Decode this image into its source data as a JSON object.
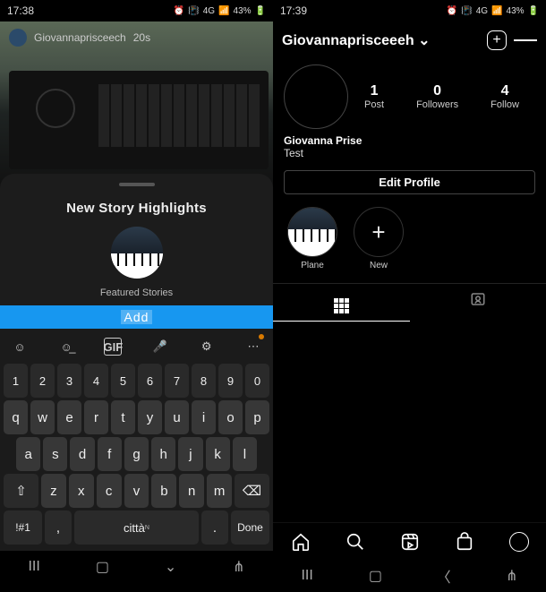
{
  "left": {
    "status": {
      "time": "17:38",
      "battery": "43%",
      "net": "4G"
    },
    "story": {
      "username": "Giovannaprisceech",
      "age": "20s"
    },
    "sheet": {
      "title": "New Story Highlights",
      "featured_label": "Featured Stories",
      "add_label": "Add"
    },
    "keyboard": {
      "toolbar_gif": "GIF",
      "row_nums": [
        "1",
        "2",
        "3",
        "4",
        "5",
        "6",
        "7",
        "8",
        "9",
        "0"
      ],
      "row1": [
        "q",
        "w",
        "e",
        "r",
        "t",
        "y",
        "u",
        "i",
        "o",
        "p"
      ],
      "row2": [
        "a",
        "s",
        "d",
        "f",
        "g",
        "h",
        "j",
        "k",
        "l"
      ],
      "row3": [
        "z",
        "x",
        "c",
        "v",
        "b",
        "n",
        "m"
      ],
      "sym_key": "!#1",
      "comma": ",",
      "space": "città",
      "period": ".",
      "done": "Done"
    }
  },
  "right": {
    "status": {
      "time": "17:39",
      "battery": "43%",
      "net": "4G"
    },
    "header": {
      "username": "Giovannaprisceeeh"
    },
    "stats": {
      "posts": {
        "n": "1",
        "label": "Post"
      },
      "followers": {
        "n": "0",
        "label": "Followers"
      },
      "following": {
        "n": "4",
        "label": "Follow"
      }
    },
    "bio": {
      "name": "Giovanna Prise",
      "text": "Test"
    },
    "edit_label": "Edit Profile",
    "highlights": {
      "item1": "Plane",
      "new_label": "New"
    }
  }
}
